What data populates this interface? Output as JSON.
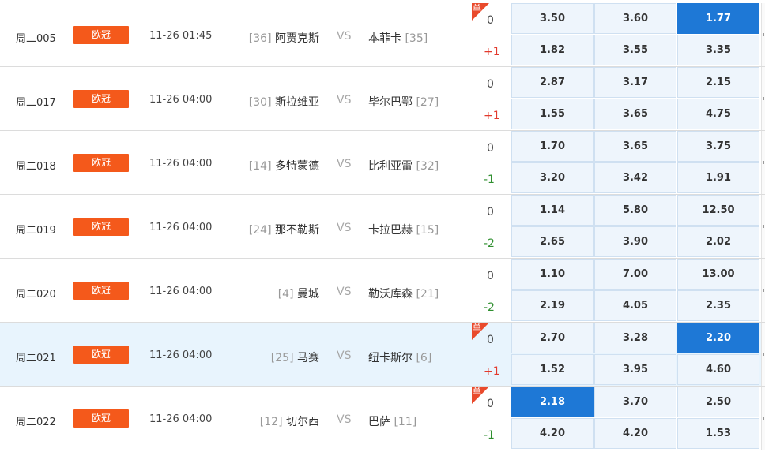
{
  "matches": [
    {
      "code": "周二005",
      "league": "欧冠",
      "time": "11-26 01:45",
      "home": {
        "rank": "[36]",
        "name": "阿贾克斯"
      },
      "vs": "VS",
      "away": {
        "name": "本菲卡",
        "rank": "[35]"
      },
      "single": true,
      "handicap": [
        "0",
        "+1"
      ],
      "odds": [
        [
          "3.50",
          "3.60",
          "1.77"
        ],
        [
          "1.82",
          "3.55",
          "3.35"
        ]
      ],
      "selected": [
        [
          0,
          2
        ]
      ]
    },
    {
      "code": "周二017",
      "league": "欧冠",
      "time": "11-26 04:00",
      "home": {
        "rank": "[30]",
        "name": "斯拉维亚"
      },
      "vs": "VS",
      "away": {
        "name": "毕尔巴鄂",
        "rank": "[27]"
      },
      "single": false,
      "handicap": [
        "0",
        "+1"
      ],
      "odds": [
        [
          "2.87",
          "3.17",
          "2.15"
        ],
        [
          "1.55",
          "3.65",
          "4.75"
        ]
      ],
      "selected": []
    },
    {
      "code": "周二018",
      "league": "欧冠",
      "time": "11-26 04:00",
      "home": {
        "rank": "[14]",
        "name": "多特蒙德"
      },
      "vs": "VS",
      "away": {
        "name": "比利亚雷",
        "rank": "[32]"
      },
      "single": false,
      "handicap": [
        "0",
        "-1"
      ],
      "odds": [
        [
          "1.70",
          "3.65",
          "3.75"
        ],
        [
          "3.20",
          "3.42",
          "1.91"
        ]
      ],
      "selected": []
    },
    {
      "code": "周二019",
      "league": "欧冠",
      "time": "11-26 04:00",
      "home": {
        "rank": "[24]",
        "name": "那不勒斯"
      },
      "vs": "VS",
      "away": {
        "name": "卡拉巴赫",
        "rank": "[15]"
      },
      "single": false,
      "handicap": [
        "0",
        "-2"
      ],
      "odds": [
        [
          "1.14",
          "5.80",
          "12.50"
        ],
        [
          "2.65",
          "3.90",
          "2.02"
        ]
      ],
      "selected": []
    },
    {
      "code": "周二020",
      "league": "欧冠",
      "time": "11-26 04:00",
      "home": {
        "rank": "[4]",
        "name": "曼城"
      },
      "vs": "VS",
      "away": {
        "name": "勒沃库森",
        "rank": "[21]"
      },
      "single": false,
      "handicap": [
        "0",
        "-2"
      ],
      "odds": [
        [
          "1.10",
          "7.00",
          "13.00"
        ],
        [
          "2.19",
          "4.05",
          "2.35"
        ]
      ],
      "selected": []
    },
    {
      "code": "周二021",
      "league": "欧冠",
      "time": "11-26 04:00",
      "home": {
        "rank": "[25]",
        "name": "马赛"
      },
      "vs": "VS",
      "away": {
        "name": "纽卡斯尔",
        "rank": "[6]"
      },
      "single": true,
      "highlight": true,
      "handicap": [
        "0",
        "+1"
      ],
      "odds": [
        [
          "2.70",
          "3.28",
          "2.20"
        ],
        [
          "1.52",
          "3.95",
          "4.60"
        ]
      ],
      "selected": [
        [
          0,
          2
        ]
      ]
    },
    {
      "code": "周二022",
      "league": "欧冠",
      "time": "11-26 04:00",
      "home": {
        "rank": "[12]",
        "name": "切尔西"
      },
      "vs": "VS",
      "away": {
        "name": "巴萨",
        "rank": "[11]"
      },
      "single": true,
      "handicap": [
        "0",
        "-1"
      ],
      "odds": [
        [
          "2.18",
          "3.70",
          "2.50"
        ],
        [
          "4.20",
          "4.20",
          "1.53"
        ]
      ],
      "selected": [
        [
          0,
          0
        ]
      ]
    }
  ],
  "single_label": "单",
  "colors": {
    "league_bg": "#f4591b",
    "selected_odd": "#1e78d6",
    "odd_bg": "#eef5fc",
    "positive": "#e23a2d",
    "negative": "#2f8f2f",
    "highlight_row": "#e8f4fd"
  }
}
